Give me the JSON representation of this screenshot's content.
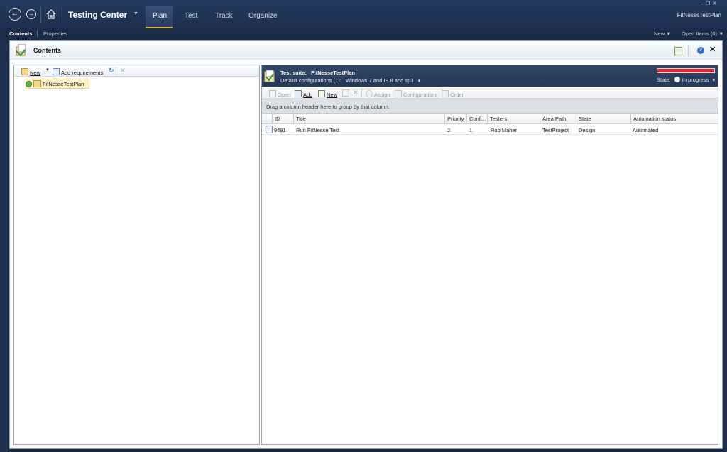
{
  "topnav": {
    "back_icon": "back-arrow-icon",
    "forward_icon": "forward-arrow-icon",
    "home_icon": "home-icon",
    "app_title": "Testing Center",
    "tabs": [
      {
        "label": "Plan",
        "active": true
      },
      {
        "label": "Test",
        "active": false
      },
      {
        "label": "Track",
        "active": false
      },
      {
        "label": "Organize",
        "active": false
      }
    ],
    "project_name": "FitNesseTestPlan",
    "window_controls": [
      "minimize",
      "restore",
      "close"
    ]
  },
  "subnav": {
    "items": [
      "Contents",
      "Properties"
    ],
    "new_label": "New",
    "open_items_label": "Open Items (0)"
  },
  "main": {
    "title": "Contents"
  },
  "left_pane": {
    "toolbar": {
      "new_label": "New",
      "add_requirements_label": "Add requirements"
    },
    "tree": [
      {
        "label": "FitNesseTestPlan",
        "selected": true
      }
    ]
  },
  "right_pane": {
    "suite_label": "Test suite:",
    "suite_name": "FitNesseTestPlan",
    "default_config_label": "Default configurations (1):",
    "default_config_value": "Windows 7 and IE 8 and sp3",
    "state_label": "State:",
    "state_value": "In progress",
    "progress_color": "#d9262a",
    "toolbar": {
      "open": "Open",
      "add": "Add",
      "new": "New",
      "assign": "Assign",
      "configurations": "Configurations",
      "order": "Order"
    },
    "group_hint": "Drag a column header here to group by that column.",
    "columns": [
      "ID",
      "Title",
      "Priority",
      "Confi...",
      "Testers",
      "Area Path",
      "State",
      "Automation status"
    ],
    "rows": [
      {
        "id": "9491",
        "title": "Run FitNesse Test",
        "priority": "2",
        "config": "1",
        "testers": "Rob Maher",
        "area_path": "TestProject",
        "state": "Design",
        "automation": "Automated"
      }
    ]
  }
}
